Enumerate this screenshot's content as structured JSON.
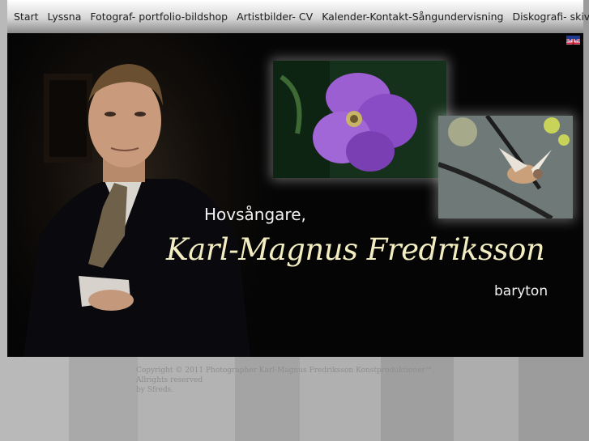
{
  "nav": {
    "items": [
      {
        "label": "Start"
      },
      {
        "label": "Lyssna"
      },
      {
        "label": "Fotograf- portfolio-bildshop"
      },
      {
        "label": "Artistbilder- CV"
      },
      {
        "label": "Kalender-Kontakt-Sångundervisning"
      },
      {
        "label": "Diskografi- skivshop"
      }
    ]
  },
  "hero": {
    "subtitle": "Hovsångare,",
    "name": "Karl-Magnus Fredriksson",
    "voice_type": "baryton"
  },
  "language_flag": "uk-flag-icon",
  "footer": {
    "copyright": "Copyright © 2011 Photographer Karl-Magnus Fredriksson Konstproduktioner™. Allrights reserved",
    "credit": "by Sfreds."
  },
  "colors": {
    "name_text": "#f3edc2",
    "stage_background": "#050505",
    "nav_text": "#1e1e1e"
  }
}
